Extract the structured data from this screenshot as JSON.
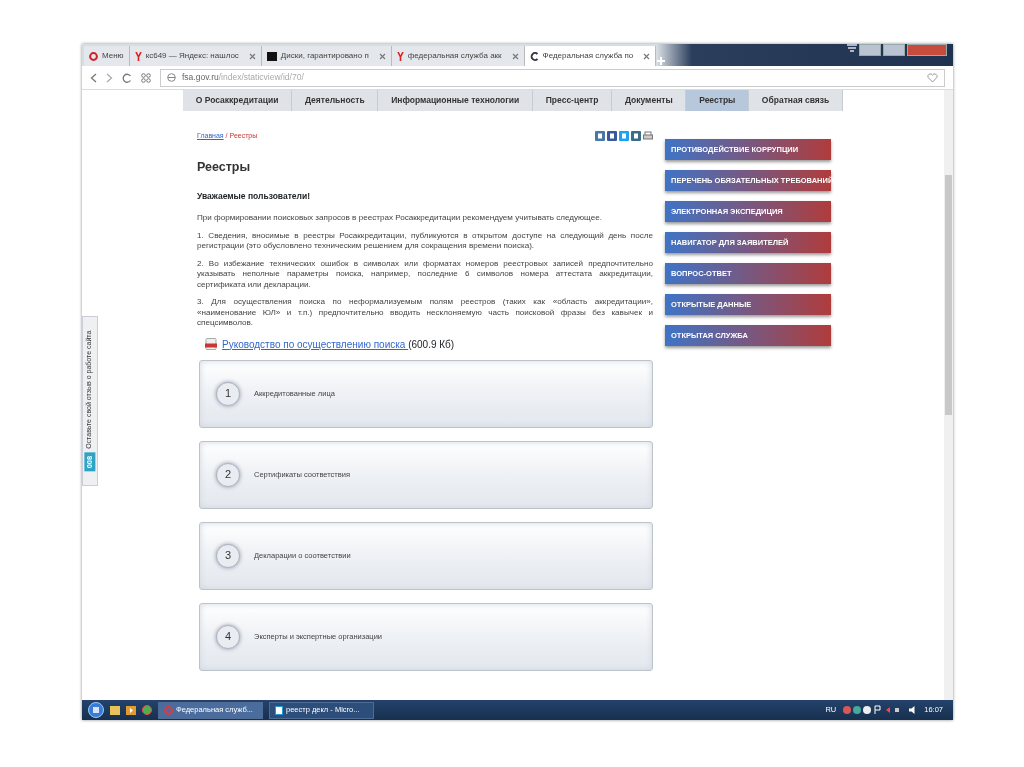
{
  "browser": {
    "tabs": [
      {
        "label": "Меню",
        "kind": "menu",
        "selected": false
      },
      {
        "label": "кс649 — Яндекс: нашлос",
        "kind": "yandex",
        "selected": false
      },
      {
        "label": "Диски, гарантировано п",
        "kind": "black",
        "selected": false
      },
      {
        "label": "федеральная служба акк",
        "kind": "yandex",
        "selected": false
      },
      {
        "label": "Федеральная служба по",
        "kind": "site",
        "selected": true
      }
    ],
    "address_host": "fsa.gov.ru",
    "address_path": "/index/staticview/id/70/"
  },
  "site": {
    "nav": [
      {
        "label": "О Росаккредитации",
        "selected": false
      },
      {
        "label": "Деятельность",
        "selected": false
      },
      {
        "label": "Информационные технологии",
        "selected": false
      },
      {
        "label": "Пресс-центр",
        "selected": false
      },
      {
        "label": "Документы",
        "selected": false
      },
      {
        "label": "Реестры",
        "selected": true
      },
      {
        "label": "Обратная связь",
        "selected": false
      }
    ],
    "breadcrumb": {
      "link": "Главная",
      "separator": "/",
      "current": "Реестры"
    },
    "title": "Реестры",
    "greeting": "Уважаемые пользователи!",
    "paragraphs": [
      "При формировании поисковых запросов в реестрах Росаккредитации рекомендуем  учитывать следующее.",
      "1. Сведения, вносимые в реестры Росаккредитации, публикуются в открытом доступе на следующий день после регистрации (это обусловлено техническим решением для сокращения времени поиска).",
      "2. Во избежание технических ошибок в символах или форматах номеров реестровых записей предпочтительно указывать неполные параметры поиска, например, последние 6 символов номера аттестата аккредитации, сертификата или декларации.",
      "3. Для осуществления поиска по неформализуемым полям реестров (таких как «область аккредитации», «наименование ЮЛ» и т.п.) предпочтительно вводить несклоняемую часть поисковой фразы без кавычек и спецсимволов."
    ],
    "document": {
      "link": "Руководство по осуществлению поиска ",
      "size": "(600.9 Кб)"
    },
    "registries": [
      {
        "number": "1",
        "label": "Аккредитованные лица"
      },
      {
        "number": "2",
        "label": "Сертификаты соответствия"
      },
      {
        "number": "3",
        "label": "Декларации о соответствии"
      },
      {
        "number": "4",
        "label": "Эксперты и экспертные организации"
      }
    ],
    "side_links": [
      "ПРОТИВОДЕЙСТВИЕ КОРРУПЦИИ",
      "ПЕРЕЧЕНЬ ОБЯЗАТЕЛЬНЫХ ТРЕБОВАНИЙ",
      "ЭЛЕКТРОННАЯ ЭКСПЕДИЦИЯ",
      "НАВИГАТОР ДЛЯ ЗАЯВИТЕЛЕЙ",
      "ВОПРОС-ОТВЕТ",
      "ОТКРЫТЫЕ ДАННЫЕ",
      "ОТКРЫТАЯ СЛУЖБА"
    ]
  },
  "feedback": {
    "count": "008",
    "label": "Оставьте свой отзыв о работе сайта"
  },
  "taskbar": {
    "windows": [
      {
        "label": "Федеральная служб...",
        "kind": "browser",
        "selected": true
      },
      {
        "label": "реестр декл - Micro...",
        "kind": "document",
        "selected": false
      }
    ],
    "language": "RU",
    "time": "16:07"
  }
}
